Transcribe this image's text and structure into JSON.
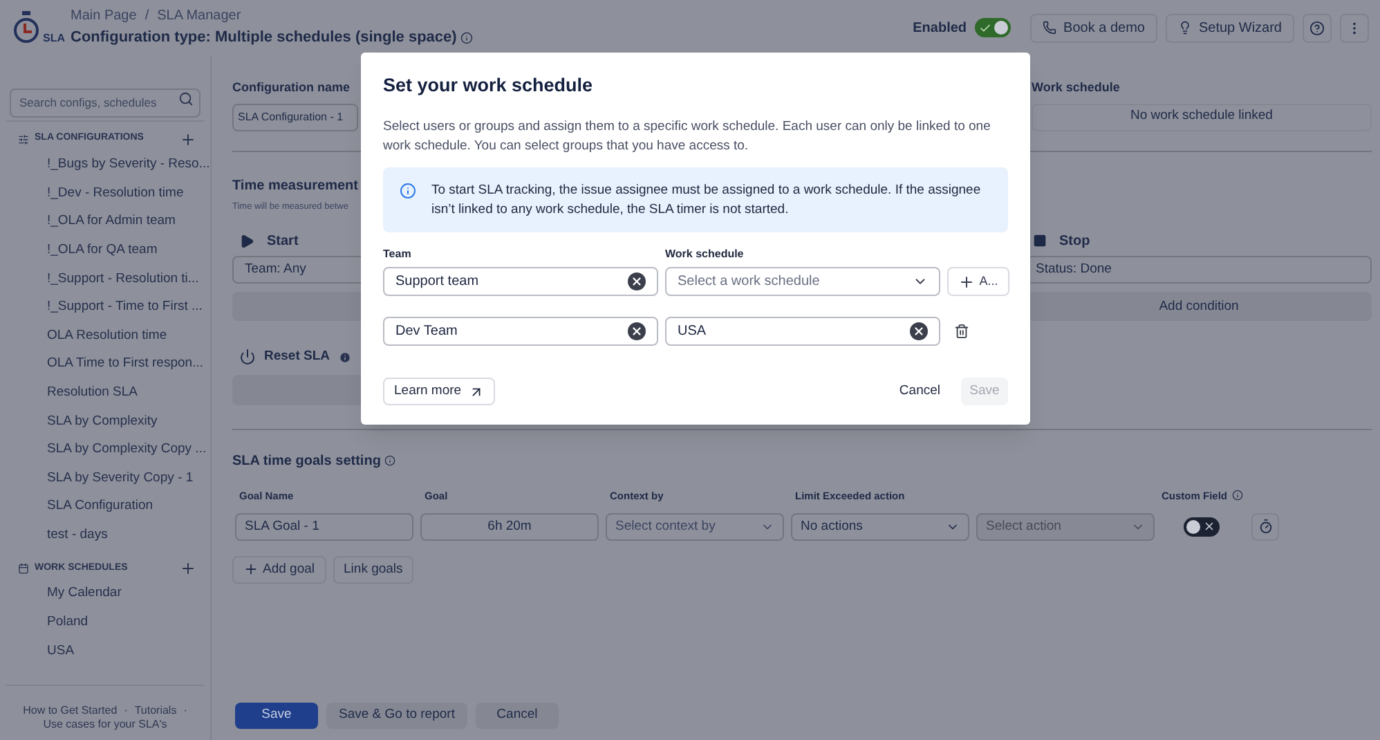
{
  "header": {
    "logo_text": "SLA",
    "breadcrumb": [
      "Main Page",
      "SLA Manager"
    ],
    "breadcrumb_separator": "/",
    "title": "Configuration type: Multiple schedules (single space)",
    "enabled": {
      "label": "Enabled",
      "on": true
    },
    "buttons": [
      "Book a demo",
      "Setup Wizard"
    ]
  },
  "sidebar": {
    "search": {
      "placeholder": "Search configs, schedules"
    },
    "sections": [
      {
        "kind": "configs",
        "title": "SLA CONFIGURATIONS",
        "items": [
          "!_Bugs by Severity - Reso...",
          "!_Dev - Resolution time",
          "!_OLA for Admin team",
          "!_OLA for QA team",
          "!_Support - Resolution ti...",
          "!_Support - Time to First ...",
          "OLA Resolution time",
          "OLA Time to First respon...",
          "Resolution SLA",
          "SLA by Complexity",
          "SLA by Complexity Copy ...",
          "SLA by Severity Copy - 1",
          "SLA Configuration",
          "test - days"
        ]
      },
      {
        "kind": "schedules",
        "title": "WORK SCHEDULES",
        "items": [
          "My Calendar",
          "Poland",
          "USA"
        ]
      }
    ],
    "footer": {
      "links": [
        "How to Get Started",
        "Tutorials",
        "Use cases for your SLA's"
      ],
      "separator": "·"
    }
  },
  "form": {
    "config_name": {
      "label": "Configuration name",
      "value": "SLA Configuration - 1"
    },
    "work_schedule": {
      "label": "Work schedule",
      "value": "No work schedule linked"
    },
    "time_measurement": {
      "title": "Time measurement",
      "subtitle": "Time will be measured betwe",
      "start": {
        "label": "Start",
        "condition": "Team: Any"
      },
      "stop": {
        "label": "Stop",
        "condition": "Status: Done"
      },
      "add_condition": "Add condition"
    },
    "reset": {
      "label": "Reset SLA"
    },
    "goals": {
      "title": "SLA time goals setting",
      "columns": [
        "Goal Name",
        "Goal",
        "Context by",
        "Limit Exceeded action",
        "Custom Field"
      ],
      "row": {
        "goal_name": "SLA Goal - 1",
        "goal": "6h 20m",
        "context": {
          "placeholder": "Select context by"
        },
        "action": {
          "value": "No actions"
        },
        "action_detail": {
          "placeholder": "Select action",
          "disabled": true
        },
        "custom_field": {
          "on": false
        }
      },
      "buttons": [
        "Add goal",
        "Link goals"
      ]
    },
    "footer_buttons": [
      "Save",
      "Save & Go to report",
      "Cancel"
    ]
  },
  "modal": {
    "title": "Set your work schedule",
    "description": "Select users or groups and assign them to a specific work schedule. Each user can only be linked to one work schedule. You can select groups that you have access to.",
    "info": "To start SLA tracking, the issue assignee must be assigned to a work schedule. If the assignee isn’t linked to any work schedule, the SLA timer is not started.",
    "columns": [
      "Team",
      "Work schedule"
    ],
    "rows": [
      {
        "team": "Support team",
        "schedule": {
          "kind": "select",
          "placeholder": "Select a work schedule"
        },
        "action": {
          "kind": "add",
          "label": "A..."
        }
      },
      {
        "team": "Dev Team",
        "schedule": {
          "kind": "filled",
          "value": "USA"
        },
        "action": {
          "kind": "delete"
        }
      }
    ],
    "learn_more": "Learn more",
    "cancel": "Cancel",
    "save": {
      "label": "Save",
      "disabled": true
    }
  }
}
